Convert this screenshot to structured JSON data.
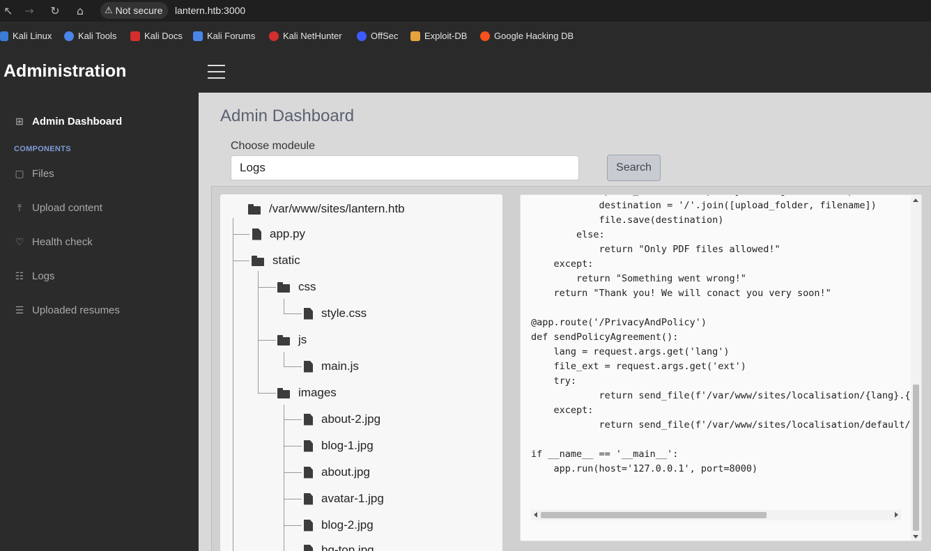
{
  "browser": {
    "security_label": "Not secure",
    "url": "lantern.htb:3000",
    "bookmarks": [
      {
        "label": "Kali Linux",
        "color": "#3a7bd5"
      },
      {
        "label": "Kali Tools",
        "color": "#4a86e8"
      },
      {
        "label": "Kali Docs",
        "color": "#d32f2f"
      },
      {
        "label": "Kali Forums",
        "color": "#4a86e8"
      },
      {
        "label": "Kali NetHunter",
        "color": "#d32f2f"
      },
      {
        "label": "OffSec",
        "color": "#3d5afe"
      },
      {
        "label": "Exploit-DB",
        "color": "#e6a23c"
      },
      {
        "label": "Google Hacking DB",
        "color": "#f4511e"
      }
    ]
  },
  "app": {
    "brand": "Administration",
    "sidebar": {
      "active_item": "Admin Dashboard",
      "section_heading": "COMPONENTS",
      "items": [
        "Files",
        "Upload content",
        "Health check",
        "Logs",
        "Uploaded resumes"
      ]
    },
    "main": {
      "title": "Admin Dashboard",
      "module_label": "Choose modeule",
      "module_value": "Logs",
      "search_label": "Search"
    },
    "tree": {
      "root": "/var/www/sites/lantern.htb",
      "nodes": [
        "app.py",
        "static",
        "css",
        "style.css",
        "js",
        "main.js",
        "images",
        "about-2.jpg",
        "blog-1.jpg",
        "about.jpg",
        "avatar-1.jpg",
        "blog-2.jpg",
        "bg-top.jpg"
      ]
    },
    "code": "            upload_folder = os.path.join(os.getcwd(), 'uploads')\n            destination = '/'.join([upload_folder, filename])\n            file.save(destination)\n        else:\n            return \"Only PDF files allowed!\"\n    except:\n        return \"Something went wrong!\"\n    return \"Thank you! We will conact you very soon!\"\n\n@app.route('/PrivacyAndPolicy')\ndef sendPolicyAgreement():\n    lang = request.args.get('lang')\n    file_ext = request.args.get('ext')\n    try:\n            return send_file(f'/var/www/sites/localisation/{lang}.{file_ext}')\n    except:\n            return send_file(f'/var/www/sites/localisation/default/policy.pdf')\n\nif __name__ == '__main__':\n    app.run(host='127.0.0.1', port=8000)"
  }
}
